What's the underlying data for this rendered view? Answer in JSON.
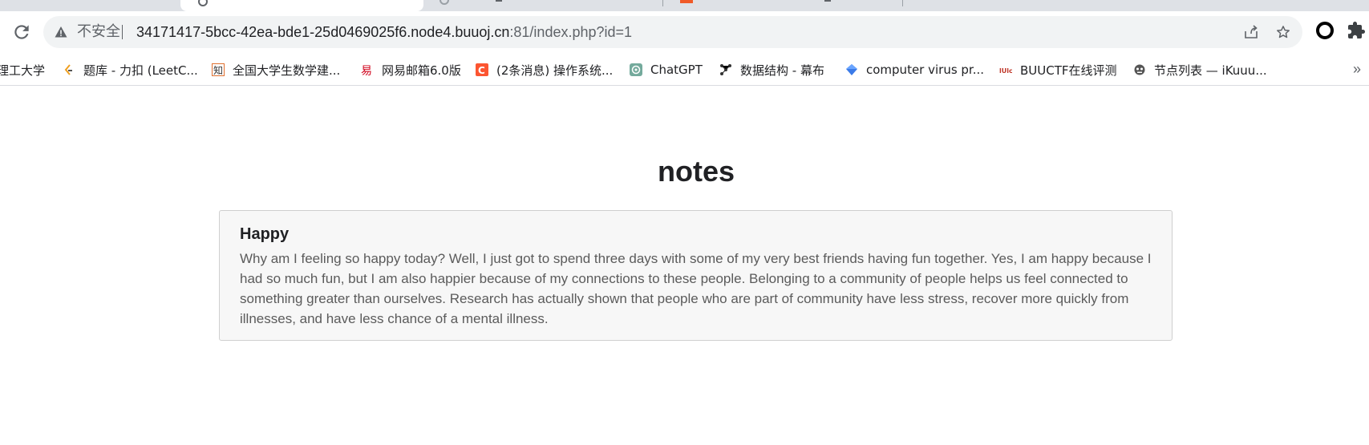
{
  "browser": {
    "address_bar": {
      "security_label": "不安全",
      "url_host": "34171417-5bcc-42ea-bde1-25d0469025f6.node4.buuoj.cn",
      "url_rest": ":81/index.php?id=1"
    },
    "bookmarks": [
      {
        "label": "理工大学",
        "icon": "university-icon"
      },
      {
        "label": "题库 - 力扣 (LeetC...",
        "icon": "leetcode-icon"
      },
      {
        "label": "全国大学生数学建...",
        "icon": "zhi-icon"
      },
      {
        "label": "网易邮箱6.0版",
        "icon": "netease-mail-icon"
      },
      {
        "label": "(2条消息) 操作系统...",
        "icon": "csdn-icon"
      },
      {
        "label": "ChatGPT",
        "icon": "chatgpt-icon"
      },
      {
        "label": "数据结构 - 幕布",
        "icon": "mubu-icon"
      },
      {
        "label": "computer virus pr...",
        "icon": "diamond-icon"
      },
      {
        "label": "BUUCTF在线评测",
        "icon": "buuctf-icon"
      },
      {
        "label": "节点列表 — iKuuu...",
        "icon": "ikuuu-icon"
      }
    ],
    "bookmarks_overflow": "»"
  },
  "page": {
    "title": "notes",
    "note": {
      "title": "Happy",
      "body": "Why am I feeling so happy today? Well, I just got to spend three days with some of my very best friends having fun together. Yes, I am happy because I had so much fun, but I am also happier because of my connections to these people. Belonging to a community of people helps us feel connected to something greater than ourselves. Research has actually shown that people who are part of community have less stress, recover more quickly from illnesses, and have less chance of a mental illness."
    }
  }
}
